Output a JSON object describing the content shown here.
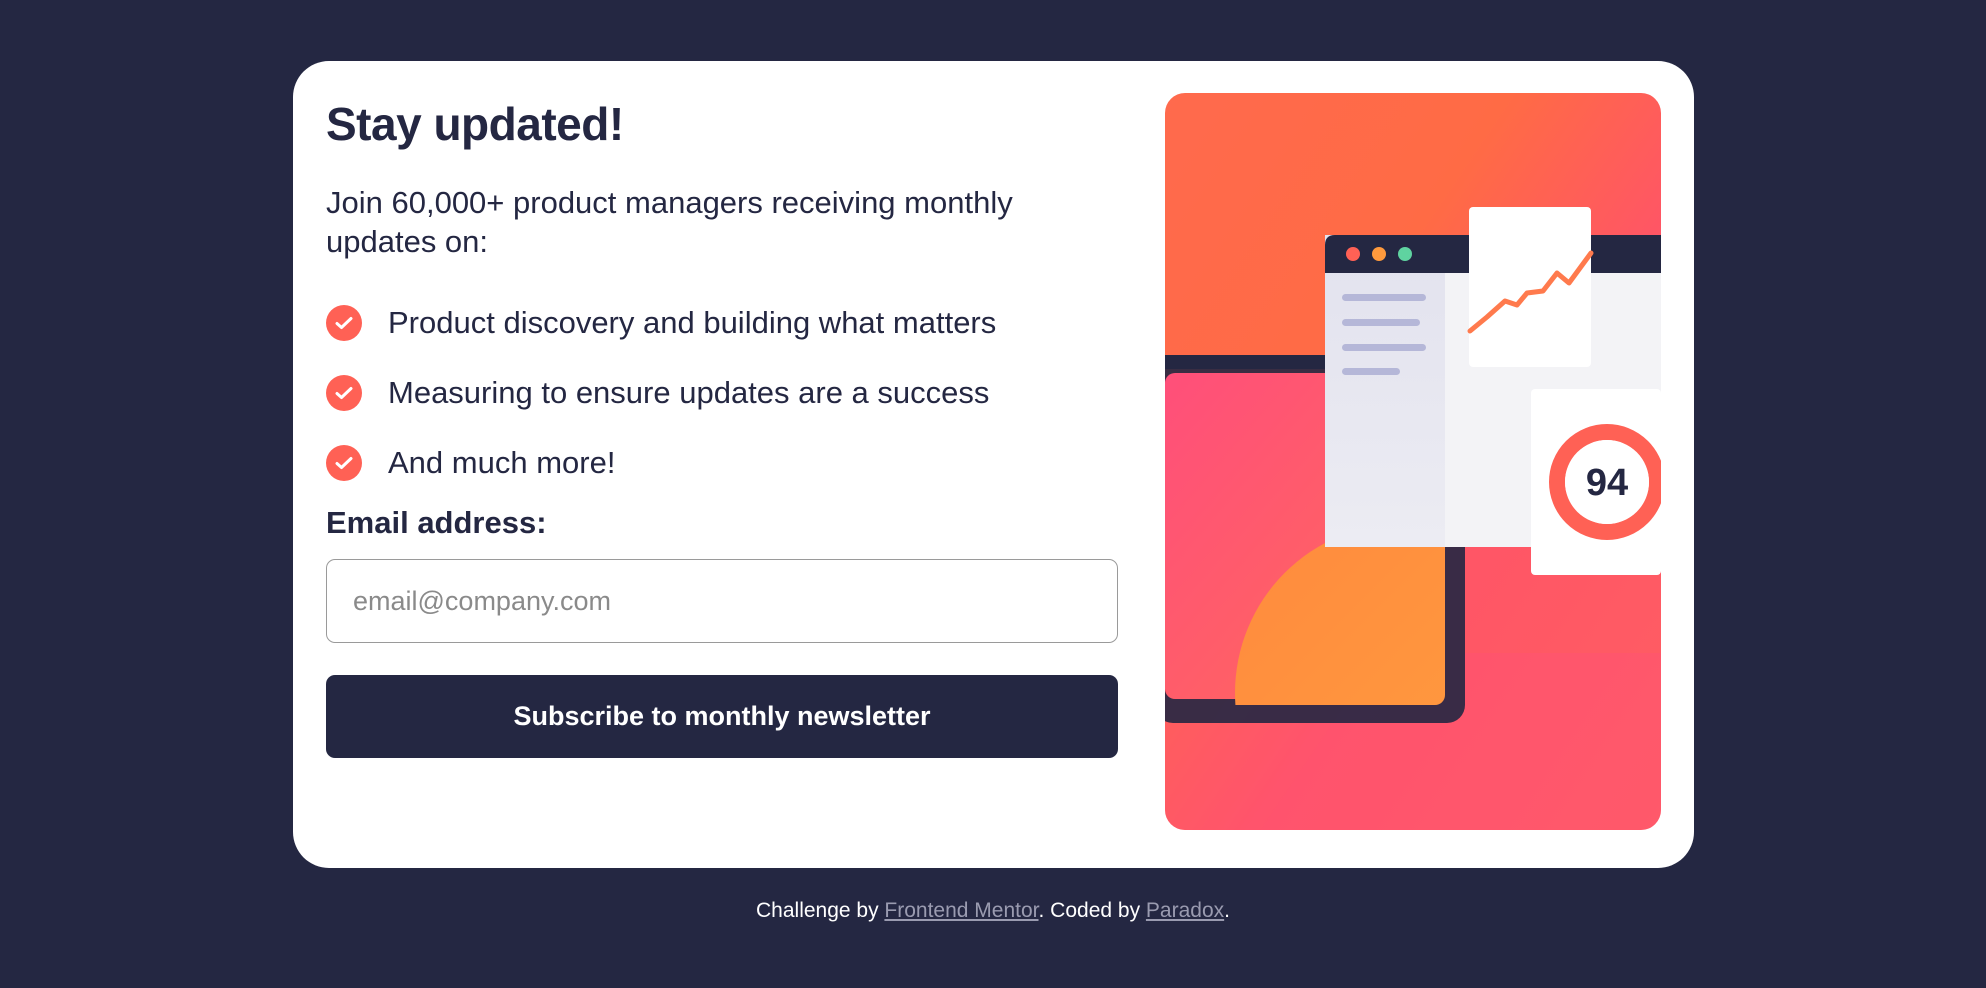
{
  "card": {
    "title": "Stay updated!",
    "intro": "Join 60,000+ product managers receiving monthly updates on:",
    "features": [
      "Product discovery and building what matters",
      "Measuring to ensure updates are a success",
      "And much more!"
    ],
    "email_label": "Email address:",
    "email_placeholder": "email@company.com",
    "email_value": "",
    "submit_label": "Subscribe to monthly newsletter"
  },
  "illustration": {
    "score": "94"
  },
  "footer": {
    "prefix": "Challenge by ",
    "challenge_link": "Frontend Mentor",
    "middle": ". Coded by ",
    "author_link": "Paradox",
    "suffix": "."
  },
  "colors": {
    "background": "#242742",
    "card": "#ffffff",
    "accent": "#ff6155",
    "text": "#242742"
  },
  "icons": [
    "check-icon"
  ]
}
